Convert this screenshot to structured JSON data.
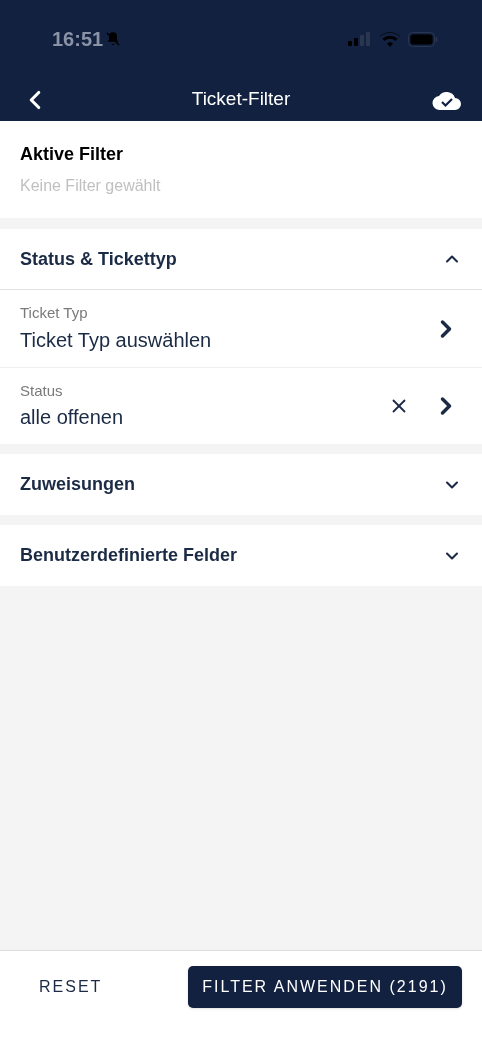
{
  "status_bar": {
    "time": "16:51"
  },
  "nav": {
    "title": "Ticket-Filter"
  },
  "active_filters": {
    "title": "Aktive Filter",
    "empty_text": "Keine Filter gewählt"
  },
  "sections": [
    {
      "title": "Status & Tickettyp",
      "expanded": true,
      "fields": [
        {
          "label": "Ticket Typ",
          "value": "Ticket Typ auswählen",
          "clearable": false
        },
        {
          "label": "Status",
          "value": "alle offenen",
          "clearable": true
        }
      ]
    },
    {
      "title": "Zuweisungen",
      "expanded": false
    },
    {
      "title": "Benutzerdefinierte Felder",
      "expanded": false
    }
  ],
  "footer": {
    "reset": "RESET",
    "apply": "FILTER ANWENDEN (2191)"
  }
}
